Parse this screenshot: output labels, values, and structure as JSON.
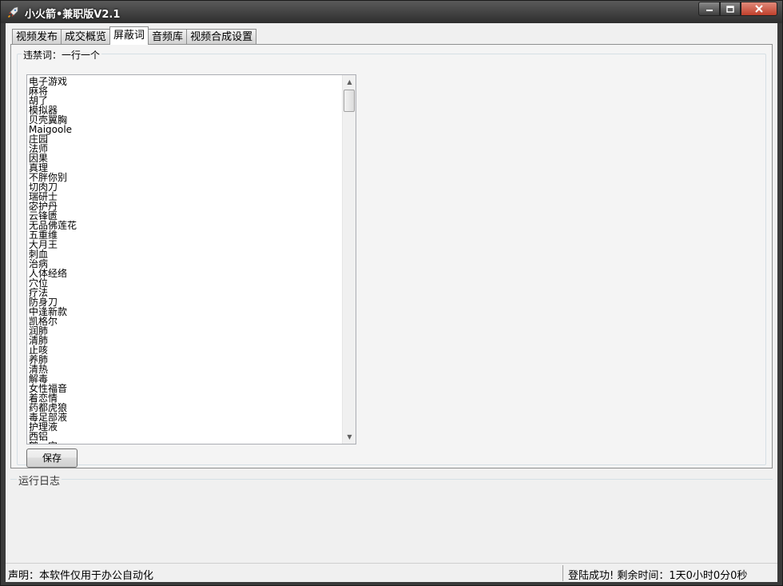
{
  "window": {
    "title": "小火箭•兼职版V2.1",
    "controls": {
      "minimize": "minimize-icon",
      "maximize": "maximize-icon",
      "close": "close-icon"
    }
  },
  "tabs": [
    {
      "label": "视频发布",
      "active": false
    },
    {
      "label": "成交概览",
      "active": false
    },
    {
      "label": "屏蔽词",
      "active": true
    },
    {
      "label": "音频库",
      "active": false
    },
    {
      "label": "视频合成设置",
      "active": false
    }
  ],
  "blocked_words": {
    "group_label": "违禁词：一行一个",
    "lines": [
      "电子游戏",
      "麻将",
      "胡了",
      "模拟器",
      "贝壳翼胸",
      "Maigoole",
      "庄园",
      "法师",
      "因果",
      "真理",
      "不胖你别",
      "切肉刀",
      "瑞研士",
      "宓护丹",
      "云锋匮",
      "无品佛莲花",
      "五重维",
      "大月王",
      "刺血",
      "治病",
      "人体经络",
      "穴位",
      "疗法",
      "防身刀",
      "中逢新款",
      "凯格尔",
      "润肺",
      "清肺",
      "止咳",
      "养肺",
      "清热",
      "解毒",
      "女性福音",
      "着恋情",
      "药都虎狼",
      "毒足部液",
      "护理液",
      "西铝",
      "鹤…宝…"
    ],
    "save_label": "保存"
  },
  "log": {
    "label": "运行日志"
  },
  "statusbar": {
    "left": "声明：本软件仅用于办公自动化",
    "right": "登陆成功! 剩余时间：1天0小时0分0秒"
  }
}
